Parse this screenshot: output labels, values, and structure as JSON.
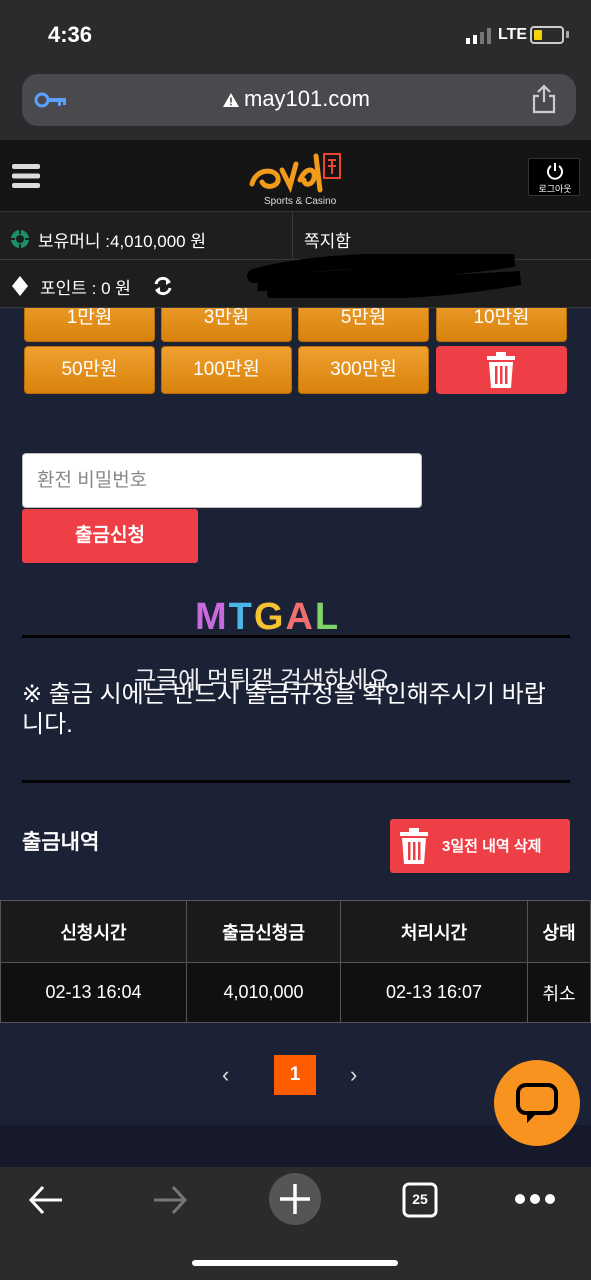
{
  "status_bar": {
    "time": "4:36",
    "network": "LTE",
    "battery_level": 0.25,
    "battery_color": "#f5d20a"
  },
  "browser": {
    "url": "may101.com",
    "tabs_count": "25"
  },
  "header": {
    "logo_tagline": "Sports & Casino",
    "logout_label": "로그아웃"
  },
  "account": {
    "money_label": "보유머니 :4,010,000 원",
    "messages_label": "쪽지함",
    "points_label": "포인트 :  0 원"
  },
  "amount_buttons": {
    "row1": [
      "1만원",
      "3만원",
      "5만원",
      "10만원"
    ],
    "row2": [
      "50만원",
      "100만원",
      "300만원"
    ]
  },
  "form": {
    "password_placeholder": "환전 비밀번호",
    "withdraw_label": "출금신청"
  },
  "watermark": {
    "logo": "MTGAL",
    "text": "구글에 먹튀갤 검색하세요."
  },
  "notice": "※ 출금 시에는 반드시 출금규정을 확인해주시기 바랍니다.",
  "history": {
    "title": "출금내역",
    "delete_label": "3일전 내역 삭제",
    "columns": [
      "신청시간",
      "출금신청금",
      "처리시간",
      "상태"
    ],
    "rows": [
      [
        "02-13 16:04",
        "4,010,000",
        "02-13 16:07",
        "취소"
      ]
    ]
  },
  "pagination": {
    "prev": "‹",
    "current": "1",
    "next": "›"
  },
  "colors": {
    "accent_orange": "#f0a030",
    "danger_red": "#ef3f46",
    "page_active": "#ff5c00",
    "chat": "#f7931e"
  }
}
